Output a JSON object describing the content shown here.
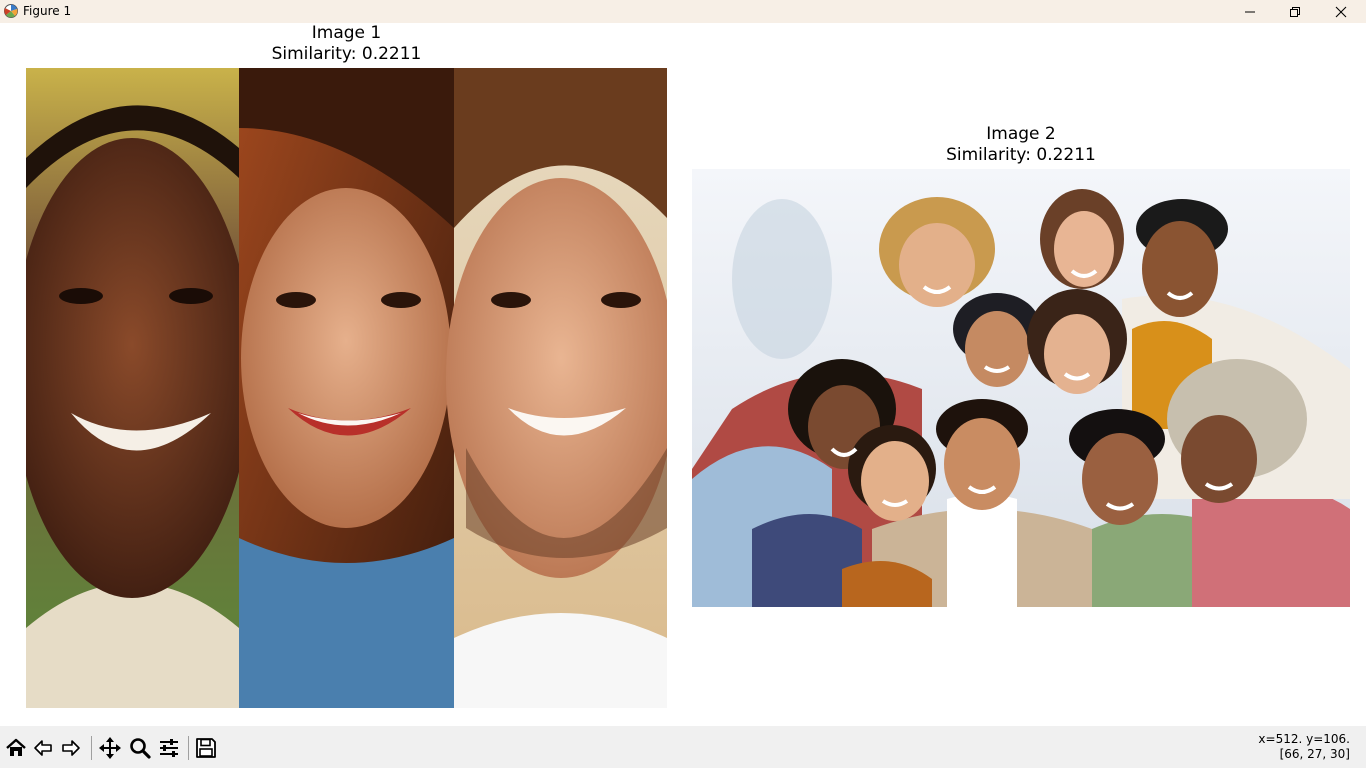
{
  "window": {
    "title": "Figure 1",
    "icons": {
      "app": "matplotlib-icon",
      "minimize": "minimize-icon",
      "maximize": "restore-icon",
      "close": "close-icon"
    }
  },
  "figure": {
    "subplots": [
      {
        "title_line1": "Image 1",
        "title_line2": "Similarity: 0.2211",
        "image_description": "three-panel close-up portraits of smiling faces"
      },
      {
        "title_line1": "Image 2",
        "title_line2": "Similarity: 0.2211",
        "image_description": "group selfie of ten smiling friends outdoors"
      }
    ]
  },
  "toolbar": {
    "buttons": [
      {
        "name": "home",
        "icon": "home-icon"
      },
      {
        "name": "back",
        "icon": "back-arrow-icon"
      },
      {
        "name": "forward",
        "icon": "forward-arrow-icon"
      },
      {
        "name": "pan",
        "icon": "move-icon"
      },
      {
        "name": "zoom",
        "icon": "zoom-icon"
      },
      {
        "name": "configure-subplots",
        "icon": "sliders-icon"
      },
      {
        "name": "save",
        "icon": "save-icon"
      }
    ],
    "coords_line1": "x=512. y=106.",
    "coords_line2": "[66, 27, 30]"
  },
  "colors": {
    "titlebar_bg": "#f7efe6",
    "toolbar_bg": "#f0f0f0",
    "figure_bg": "#ffffff"
  }
}
